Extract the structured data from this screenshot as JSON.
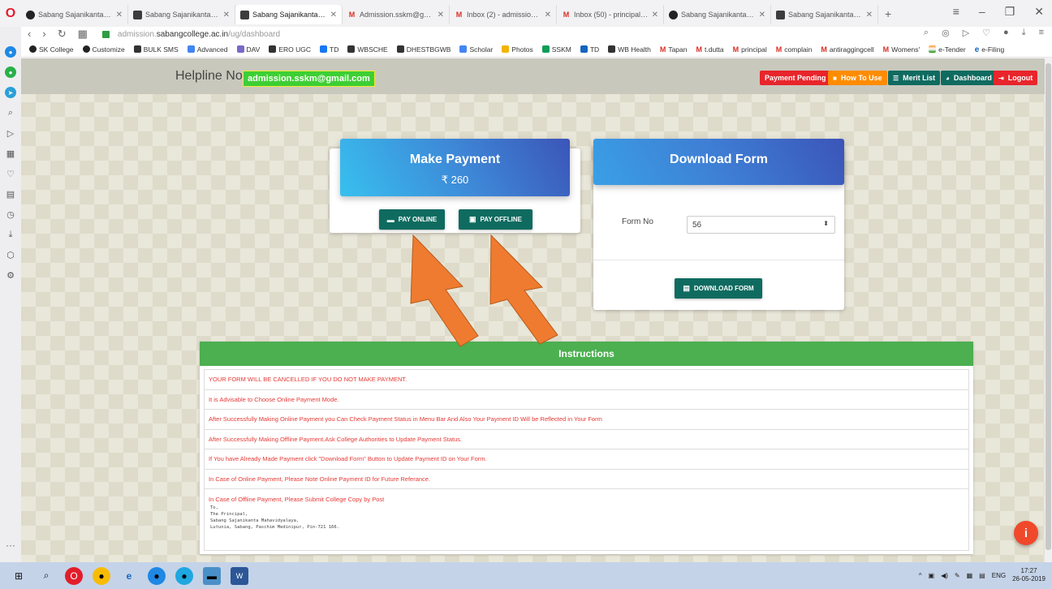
{
  "browser": {
    "tabs": [
      {
        "icon": "sabang-favicon",
        "label": "Sabang Sajanikanta Mahav",
        "active": false
      },
      {
        "icon": "doc-favicon",
        "label": "Sabang Sajanikanta Mahav",
        "active": false
      },
      {
        "icon": "doc-favicon",
        "label": "Sabang Sajanikanta Mahav",
        "active": true
      },
      {
        "icon": "gmail-icon",
        "label": "Admission.sskm@gmail.co",
        "active": false
      },
      {
        "icon": "gmail-icon",
        "label": "Inbox (2) - admission.sskm",
        "active": false
      },
      {
        "icon": "gmail-icon",
        "label": "Inbox (50) - principal.sskm",
        "active": false
      },
      {
        "icon": "sabang-favicon",
        "label": "Sabang Sajanikanta Mahav",
        "active": false
      },
      {
        "icon": "doc-favicon",
        "label": "Sabang Sajanikanta Mahav",
        "active": false
      }
    ],
    "url_prefix": "admission.",
    "url_domain": "sabangcollege.ac.in",
    "url_path": "/ug/dashboard",
    "bookmarks": [
      "SK College",
      "Customize",
      "BULK SMS",
      "Advanced",
      "DAV",
      "ERO UGC",
      "TD",
      "WBSCHE",
      "DHESTBGWB",
      "Scholar",
      "Photos",
      "SSKM",
      "TD",
      "WB Health",
      "Tapan",
      "t.dutta",
      "principal",
      "complain",
      "antiraggingcell",
      "Womens'",
      "e-Tender",
      "e-Filing"
    ]
  },
  "header": {
    "helpline_label": "Helpline No.",
    "helpline_email": "admission.sskm@gmail.com",
    "payment_pending": "Payment Pending",
    "how_to_use": "How To Use",
    "merit_list": "Merit List",
    "dashboard": "Dashboard",
    "logout": "Logout"
  },
  "payment": {
    "title": "Make Payment",
    "amount": "₹ 260",
    "pay_online": "PAY ONLINE",
    "pay_offline": "PAY OFFLINE"
  },
  "download": {
    "title": "Download Form",
    "form_no_label": "Form No",
    "form_no_value": "56",
    "button": "DOWNLOAD FORM"
  },
  "instructions": {
    "title": "Instructions",
    "items": [
      "YOUR FORM WILL BE CANCELLED IF YOU DO NOT MAKE PAYMENT.",
      "It is Advisable to Choose Online Payment Mode.",
      "After Successfully Making Online Payment you Can Check Payment Status in Menu Bar And Also Your Payment ID Will be Reflected in Your Form",
      "After Successfully Making Offline Payment.Ask College Authorities to Update Payment Status.",
      "If You have Already Made Payment click \"Download Form\" Button to Update Payment ID on Your Form.",
      "In Case of Online Payment, Please Note Online Payment ID for Future Referance.",
      "In Case of Offline Payment, Please Submit College Copy by Post"
    ],
    "address": [
      "To,",
      "The Principal,",
      "Sabang Sajanikanta Mahavidyalaya,",
      "Lutunia, Sabang, Paschim Medinipur, Pin-721 166."
    ]
  },
  "fab_label": "i",
  "taskbar": {
    "language": "ENG",
    "time": "17:27",
    "date": "26-05-2019"
  },
  "colors": {
    "header_bar": "#c9c8bd",
    "payment_pending": "#e8252b",
    "how_to_use": "#ff8c00",
    "merit_list": "#0f6b60",
    "dashboard": "#0f6b60",
    "logout": "#e8252b",
    "instructions_header": "#4caf50",
    "instruction_text": "#e53935",
    "arrow_fill": "#ef7b30"
  }
}
